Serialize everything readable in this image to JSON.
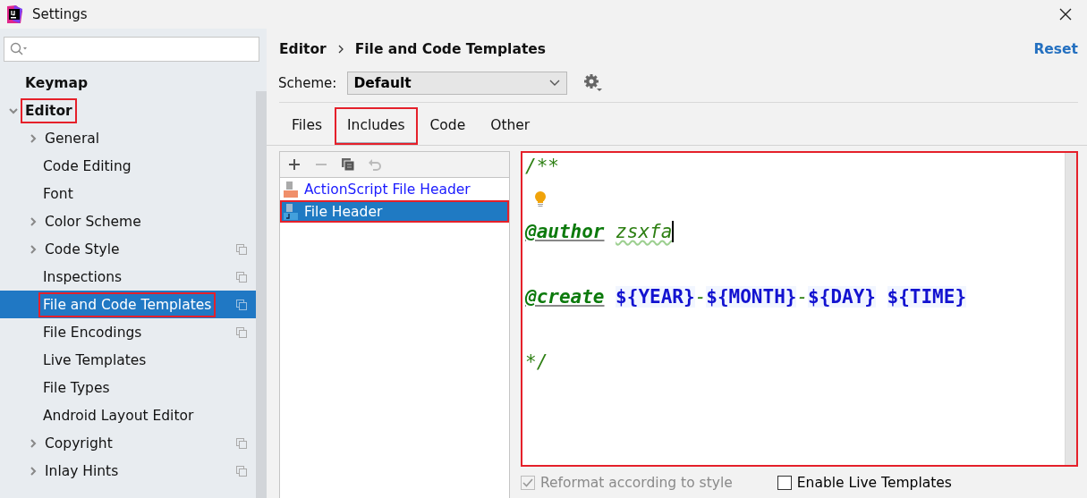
{
  "window": {
    "title": "Settings"
  },
  "sidebar": {
    "items": [
      {
        "label": "Keymap",
        "bold": true,
        "selected": false
      },
      {
        "label": "Editor",
        "bold": true,
        "expanded": true,
        "selected": false,
        "highlighted": true,
        "children": [
          {
            "label": "General",
            "expandable": true,
            "selected": false
          },
          {
            "label": "Code Editing",
            "selected": false
          },
          {
            "label": "Font",
            "selected": false
          },
          {
            "label": "Color Scheme",
            "expandable": true,
            "selected": false
          },
          {
            "label": "Code Style",
            "expandable": true,
            "project": true,
            "selected": false
          },
          {
            "label": "Inspections",
            "project": true,
            "selected": false
          },
          {
            "label": "File and Code Templates",
            "project": true,
            "selected": true,
            "highlighted": true
          },
          {
            "label": "File Encodings",
            "project": true,
            "selected": false
          },
          {
            "label": "Live Templates",
            "selected": false
          },
          {
            "label": "File Types",
            "selected": false
          },
          {
            "label": "Android Layout Editor",
            "selected": false
          },
          {
            "label": "Copyright",
            "expandable": true,
            "project": true,
            "selected": false
          },
          {
            "label": "Inlay Hints",
            "expandable": true,
            "project": true,
            "selected": false
          }
        ]
      }
    ]
  },
  "breadcrumb": [
    "Editor",
    "File and Code Templates"
  ],
  "reset": "Reset",
  "scheme": {
    "label": "Scheme:",
    "value": "Default"
  },
  "tabs": [
    {
      "label": "Files",
      "selected": false
    },
    {
      "label": "Includes",
      "selected": true,
      "highlighted": true
    },
    {
      "label": "Code",
      "selected": false
    },
    {
      "label": "Other",
      "selected": false
    }
  ],
  "templates": [
    {
      "name": "ActionScript File Header",
      "kind": "as",
      "selected": false
    },
    {
      "name": "File Header",
      "kind": "java",
      "selected": true,
      "highlighted": true
    }
  ],
  "editor": {
    "highlighted": true,
    "lines": [
      {
        "kind": "code",
        "segments": [
          {
            "kind": "comment",
            "text": "/**"
          }
        ]
      },
      {
        "kind": "bulb"
      },
      {
        "kind": "code",
        "segments": [
          {
            "kind": "tag",
            "text": "@author"
          },
          {
            "kind": "typo",
            "text": "zsxfa",
            "space_before": true
          }
        ],
        "caret": true
      },
      {
        "kind": "blank"
      },
      {
        "kind": "code",
        "segments": [
          {
            "kind": "tag",
            "text": "@create"
          },
          {
            "kind": "macro",
            "text": "${YEAR}",
            "space_before": true
          },
          {
            "kind": "comment",
            "text": "-"
          },
          {
            "kind": "macro",
            "text": "${MONTH}"
          },
          {
            "kind": "comment",
            "text": "-"
          },
          {
            "kind": "macro",
            "text": "${DAY}"
          },
          {
            "kind": "macro",
            "text": "${TIME}",
            "space_before": true
          }
        ]
      },
      {
        "kind": "blank"
      },
      {
        "kind": "code",
        "segments": [
          {
            "kind": "comment",
            "text": "*/"
          }
        ]
      }
    ]
  },
  "options": [
    {
      "label": "Reformat according to style",
      "checked": true,
      "disabled": true
    },
    {
      "label": "Enable Live Templates",
      "checked": false,
      "disabled": false
    }
  ]
}
